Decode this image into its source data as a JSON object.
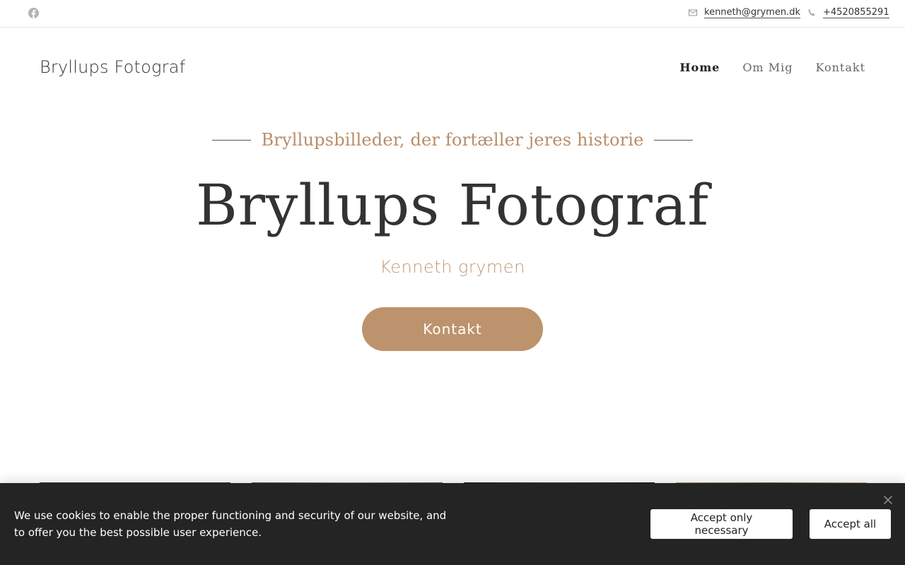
{
  "topbar": {
    "social_icon": "facebook-icon",
    "email": "kenneth@grymen.dk",
    "email_icon": "mail-icon",
    "phone": "+4520855291",
    "phone_icon": "phone-icon"
  },
  "header": {
    "brand": "Bryllups Fotograf",
    "nav": [
      {
        "label": "Home",
        "active": true
      },
      {
        "label": "Om Mig",
        "active": false
      },
      {
        "label": "Kontakt",
        "active": false
      }
    ]
  },
  "hero": {
    "tagline": "Bryllupsbilleder, der fortæller jeres historie",
    "title": "Bryllups Fotograf",
    "subtitle": "Kenneth grymen",
    "cta_label": "Kontakt"
  },
  "cookie": {
    "text": "We use cookies to enable the proper functioning and security of our website, and to offer you the best possible user experience.",
    "necessary_label": "Accept only necessary",
    "all_label": "Accept all",
    "close_icon": "close-icon"
  },
  "colors": {
    "accent": "#bd936d",
    "tagline": "#b98d68",
    "cookie_bg": "#242424"
  }
}
